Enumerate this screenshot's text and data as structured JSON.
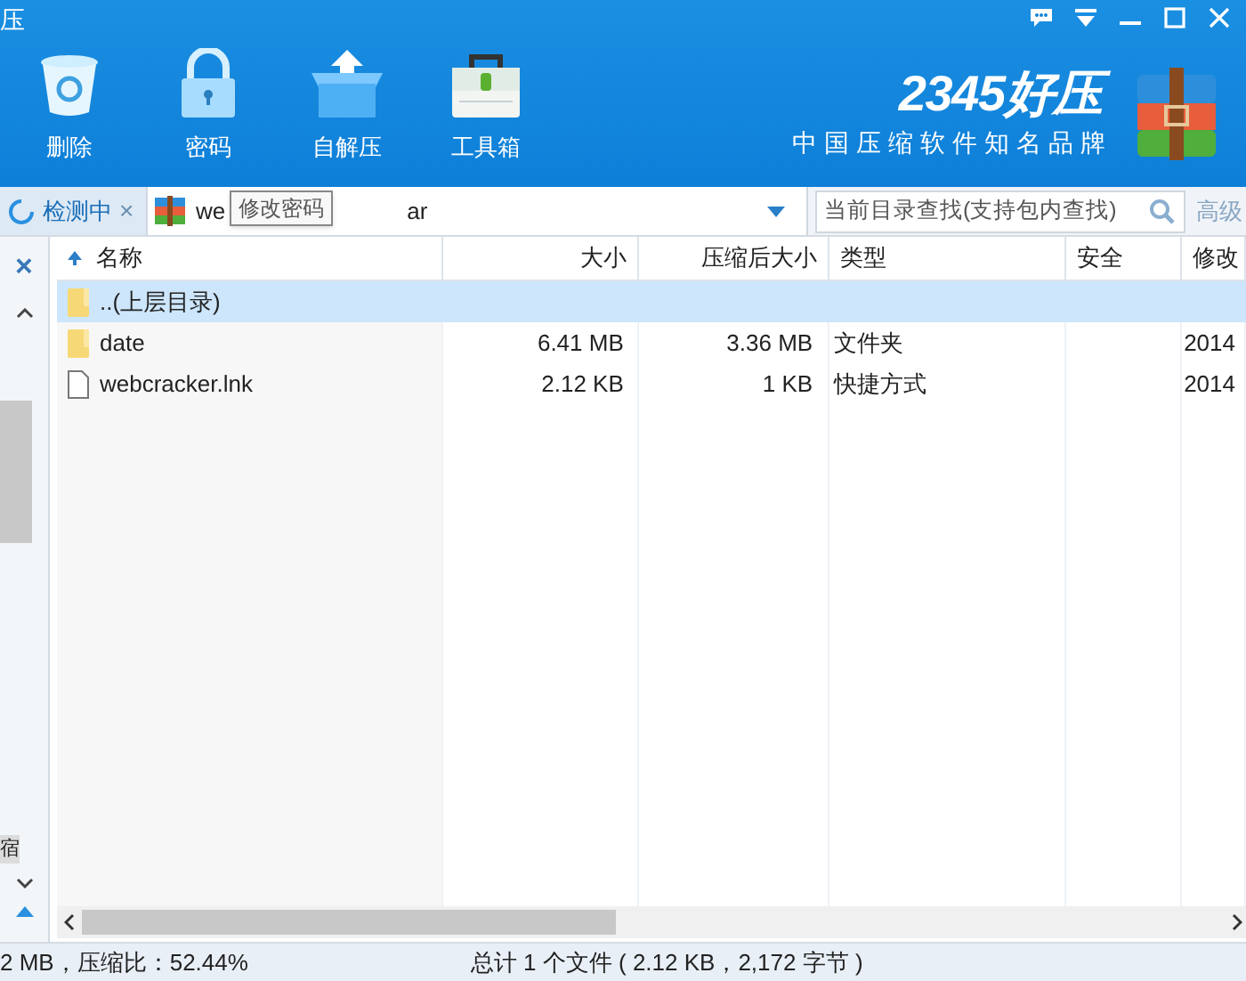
{
  "window": {
    "title": "压"
  },
  "toolbar": [
    {
      "label": "删除",
      "kind": "trash"
    },
    {
      "label": "密码",
      "kind": "lock"
    },
    {
      "label": "自解压",
      "kind": "box"
    },
    {
      "label": "工具箱",
      "kind": "toolbox"
    }
  ],
  "logo": {
    "name": "2345好压",
    "slogan": "中国压缩软件知名品牌"
  },
  "scan_tab": {
    "label": "检测中",
    "close": "×"
  },
  "address": {
    "start": "we",
    "end": "ar"
  },
  "tooltip": "修改密码",
  "search": {
    "placeholder": "当前目录查找(支持包内查找)",
    "advanced": "高级"
  },
  "sidebar": {
    "close": "×",
    "cut_label": "宿"
  },
  "table": {
    "columns": [
      "名称",
      "大小",
      "压缩后大小",
      "类型",
      "安全",
      "修改"
    ],
    "rows": [
      {
        "kind": "folder",
        "cells": [
          "..(上层目录)",
          "",
          "",
          "",
          "",
          ""
        ],
        "selected": true
      },
      {
        "kind": "folder",
        "cells": [
          "date",
          "6.41 MB",
          "3.36 MB",
          "文件夹",
          "",
          "2014"
        ],
        "selected": false
      },
      {
        "kind": "file",
        "cells": [
          "webcracker.lnk",
          "2.12 KB",
          "1 KB",
          "快捷方式",
          "",
          "2014"
        ],
        "selected": false
      }
    ]
  },
  "status_bar": {
    "left": "2 MB，压缩比：52.44%",
    "center": "总计 1 个文件 ( 2.12 KB，2,172 字节 )"
  }
}
